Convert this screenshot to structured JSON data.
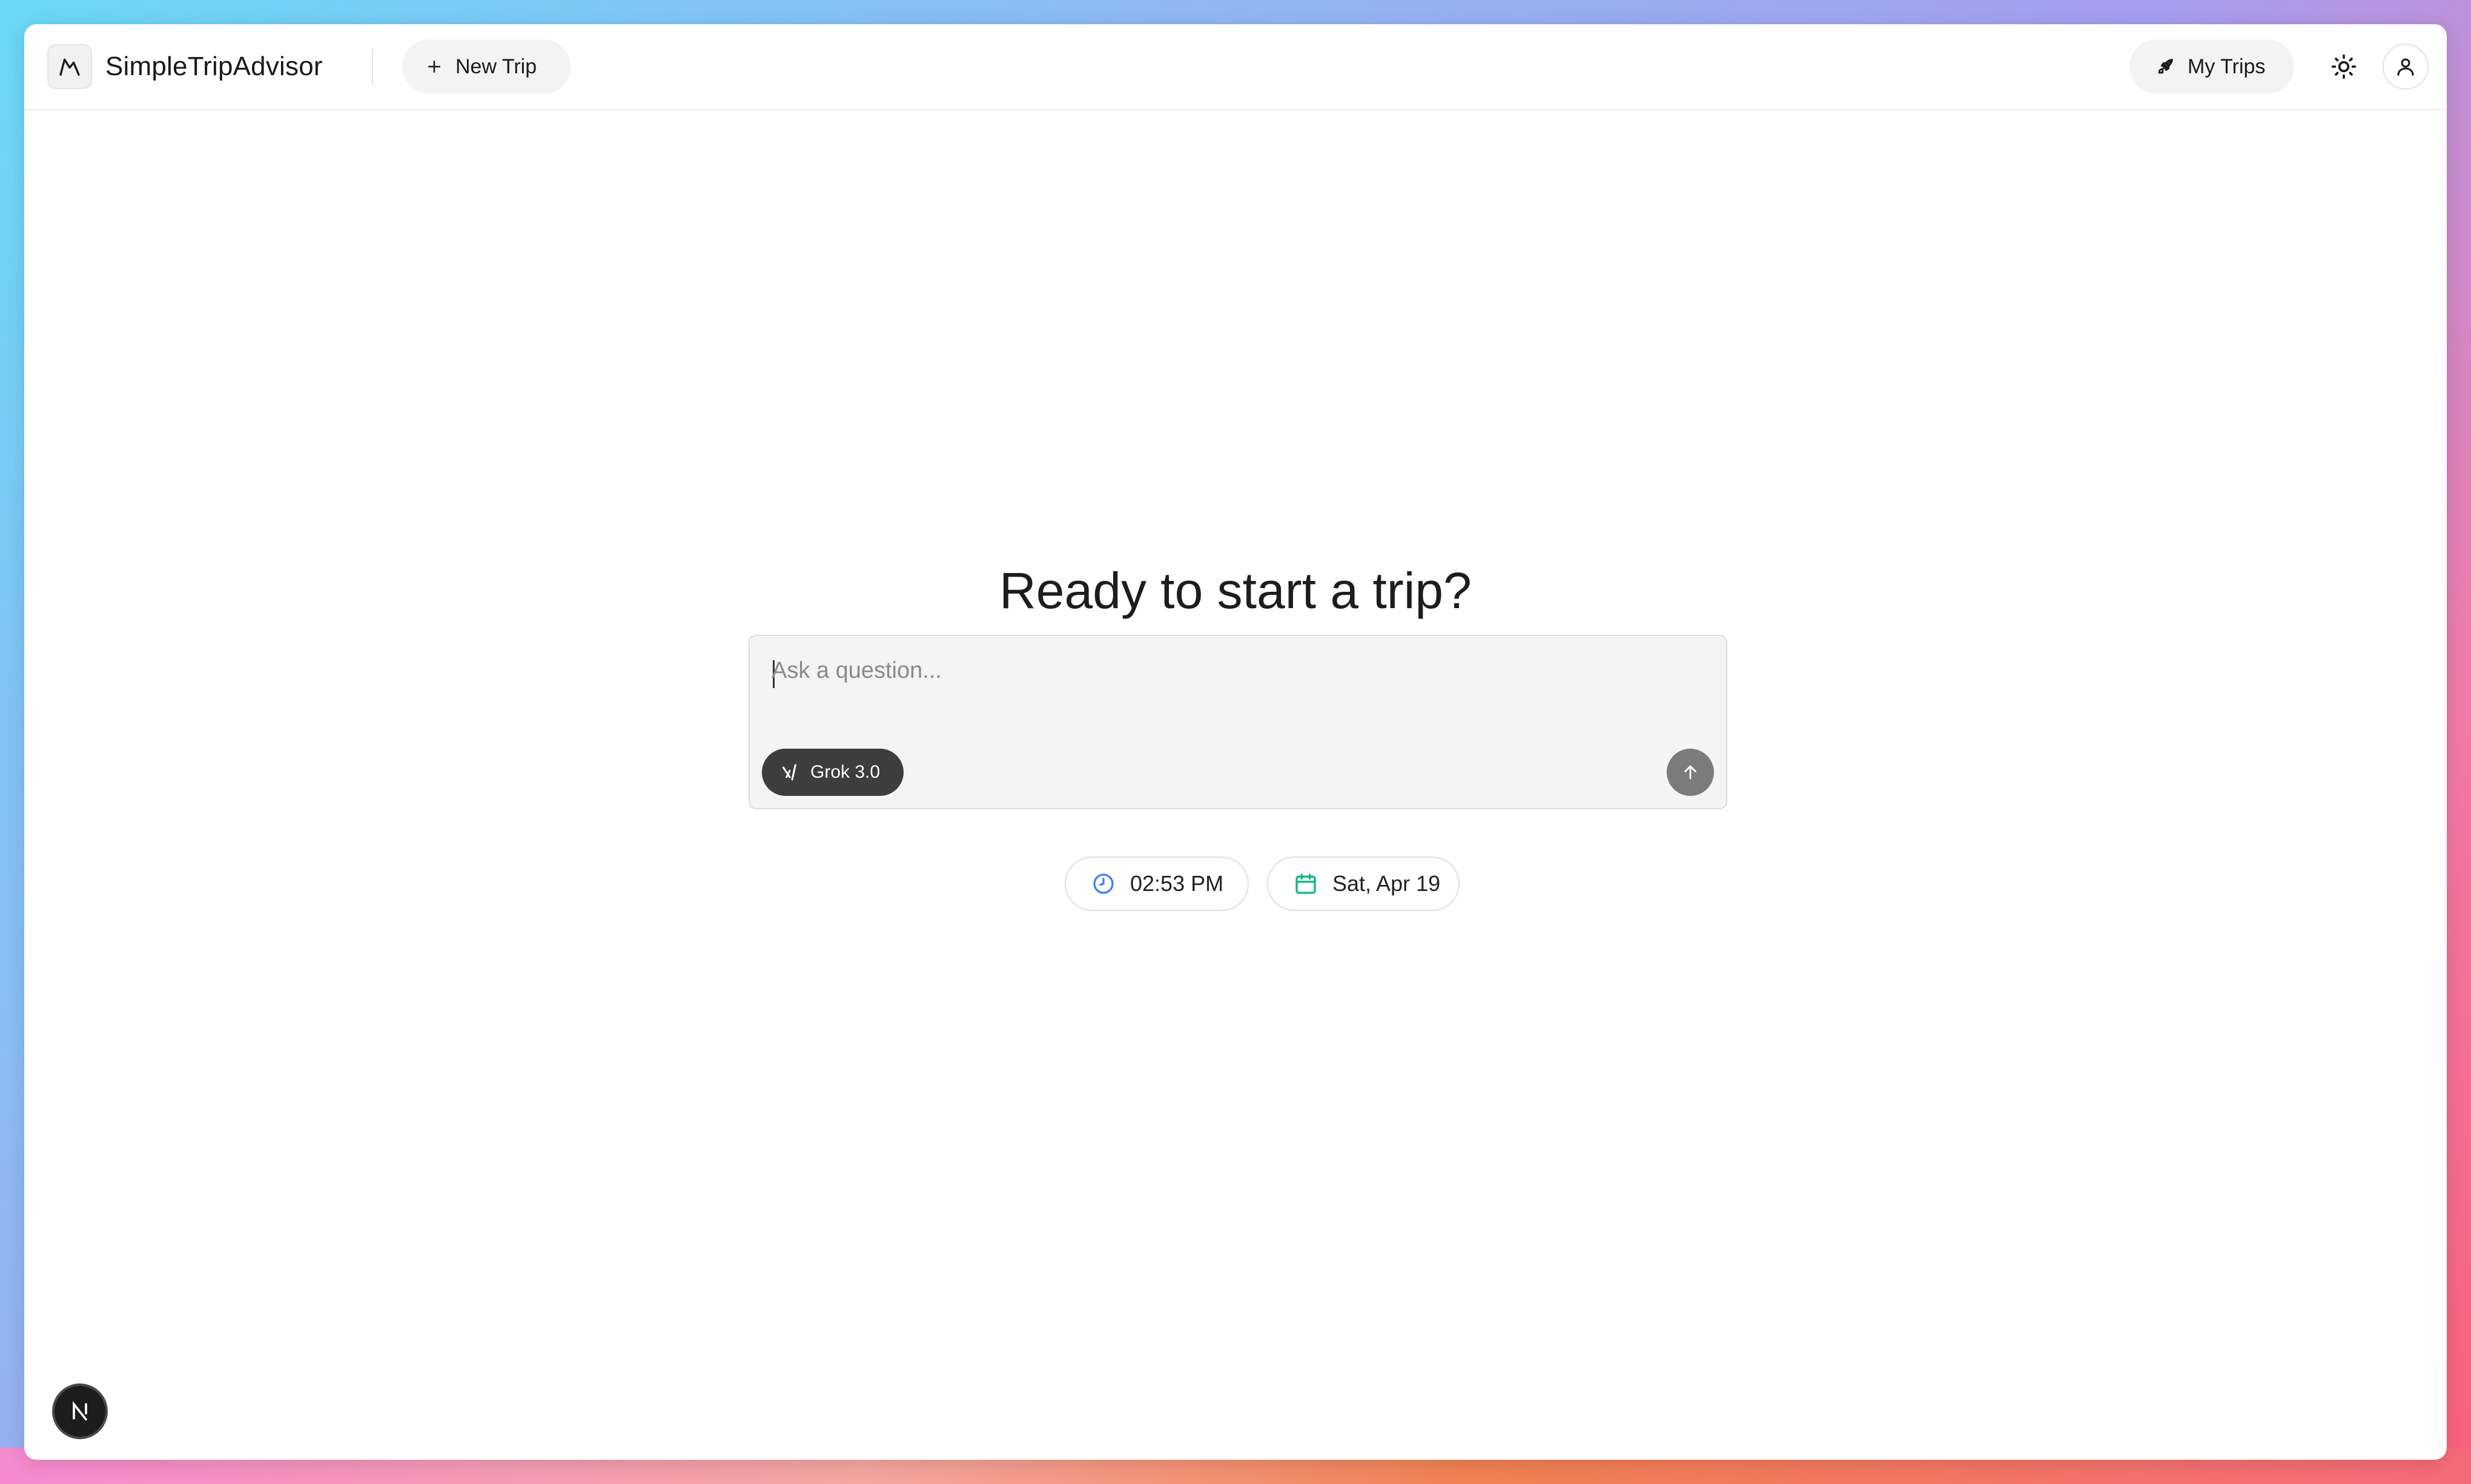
{
  "app": {
    "title": "SimpleTripAdvisor",
    "logo_icon": "mountain-icon"
  },
  "header": {
    "new_trip_label": "New Trip",
    "my_trips_label": "My Trips",
    "theme_icon": "sun-icon",
    "user_icon": "user-icon"
  },
  "main": {
    "headline": "Ready to start a trip?",
    "composer": {
      "placeholder": "Ask a question...",
      "value": "",
      "model_label": "Grok 3.0",
      "model_icon": "xai-icon",
      "send_icon": "arrow-up-icon"
    },
    "chips": {
      "time": "02:53 PM",
      "time_icon": "clock-icon",
      "time_icon_color": "#3b82f6",
      "date": "Sat, Apr 19",
      "date_icon": "calendar-icon",
      "date_icon_color": "#10b981"
    }
  },
  "badge": {
    "letter": "N"
  }
}
